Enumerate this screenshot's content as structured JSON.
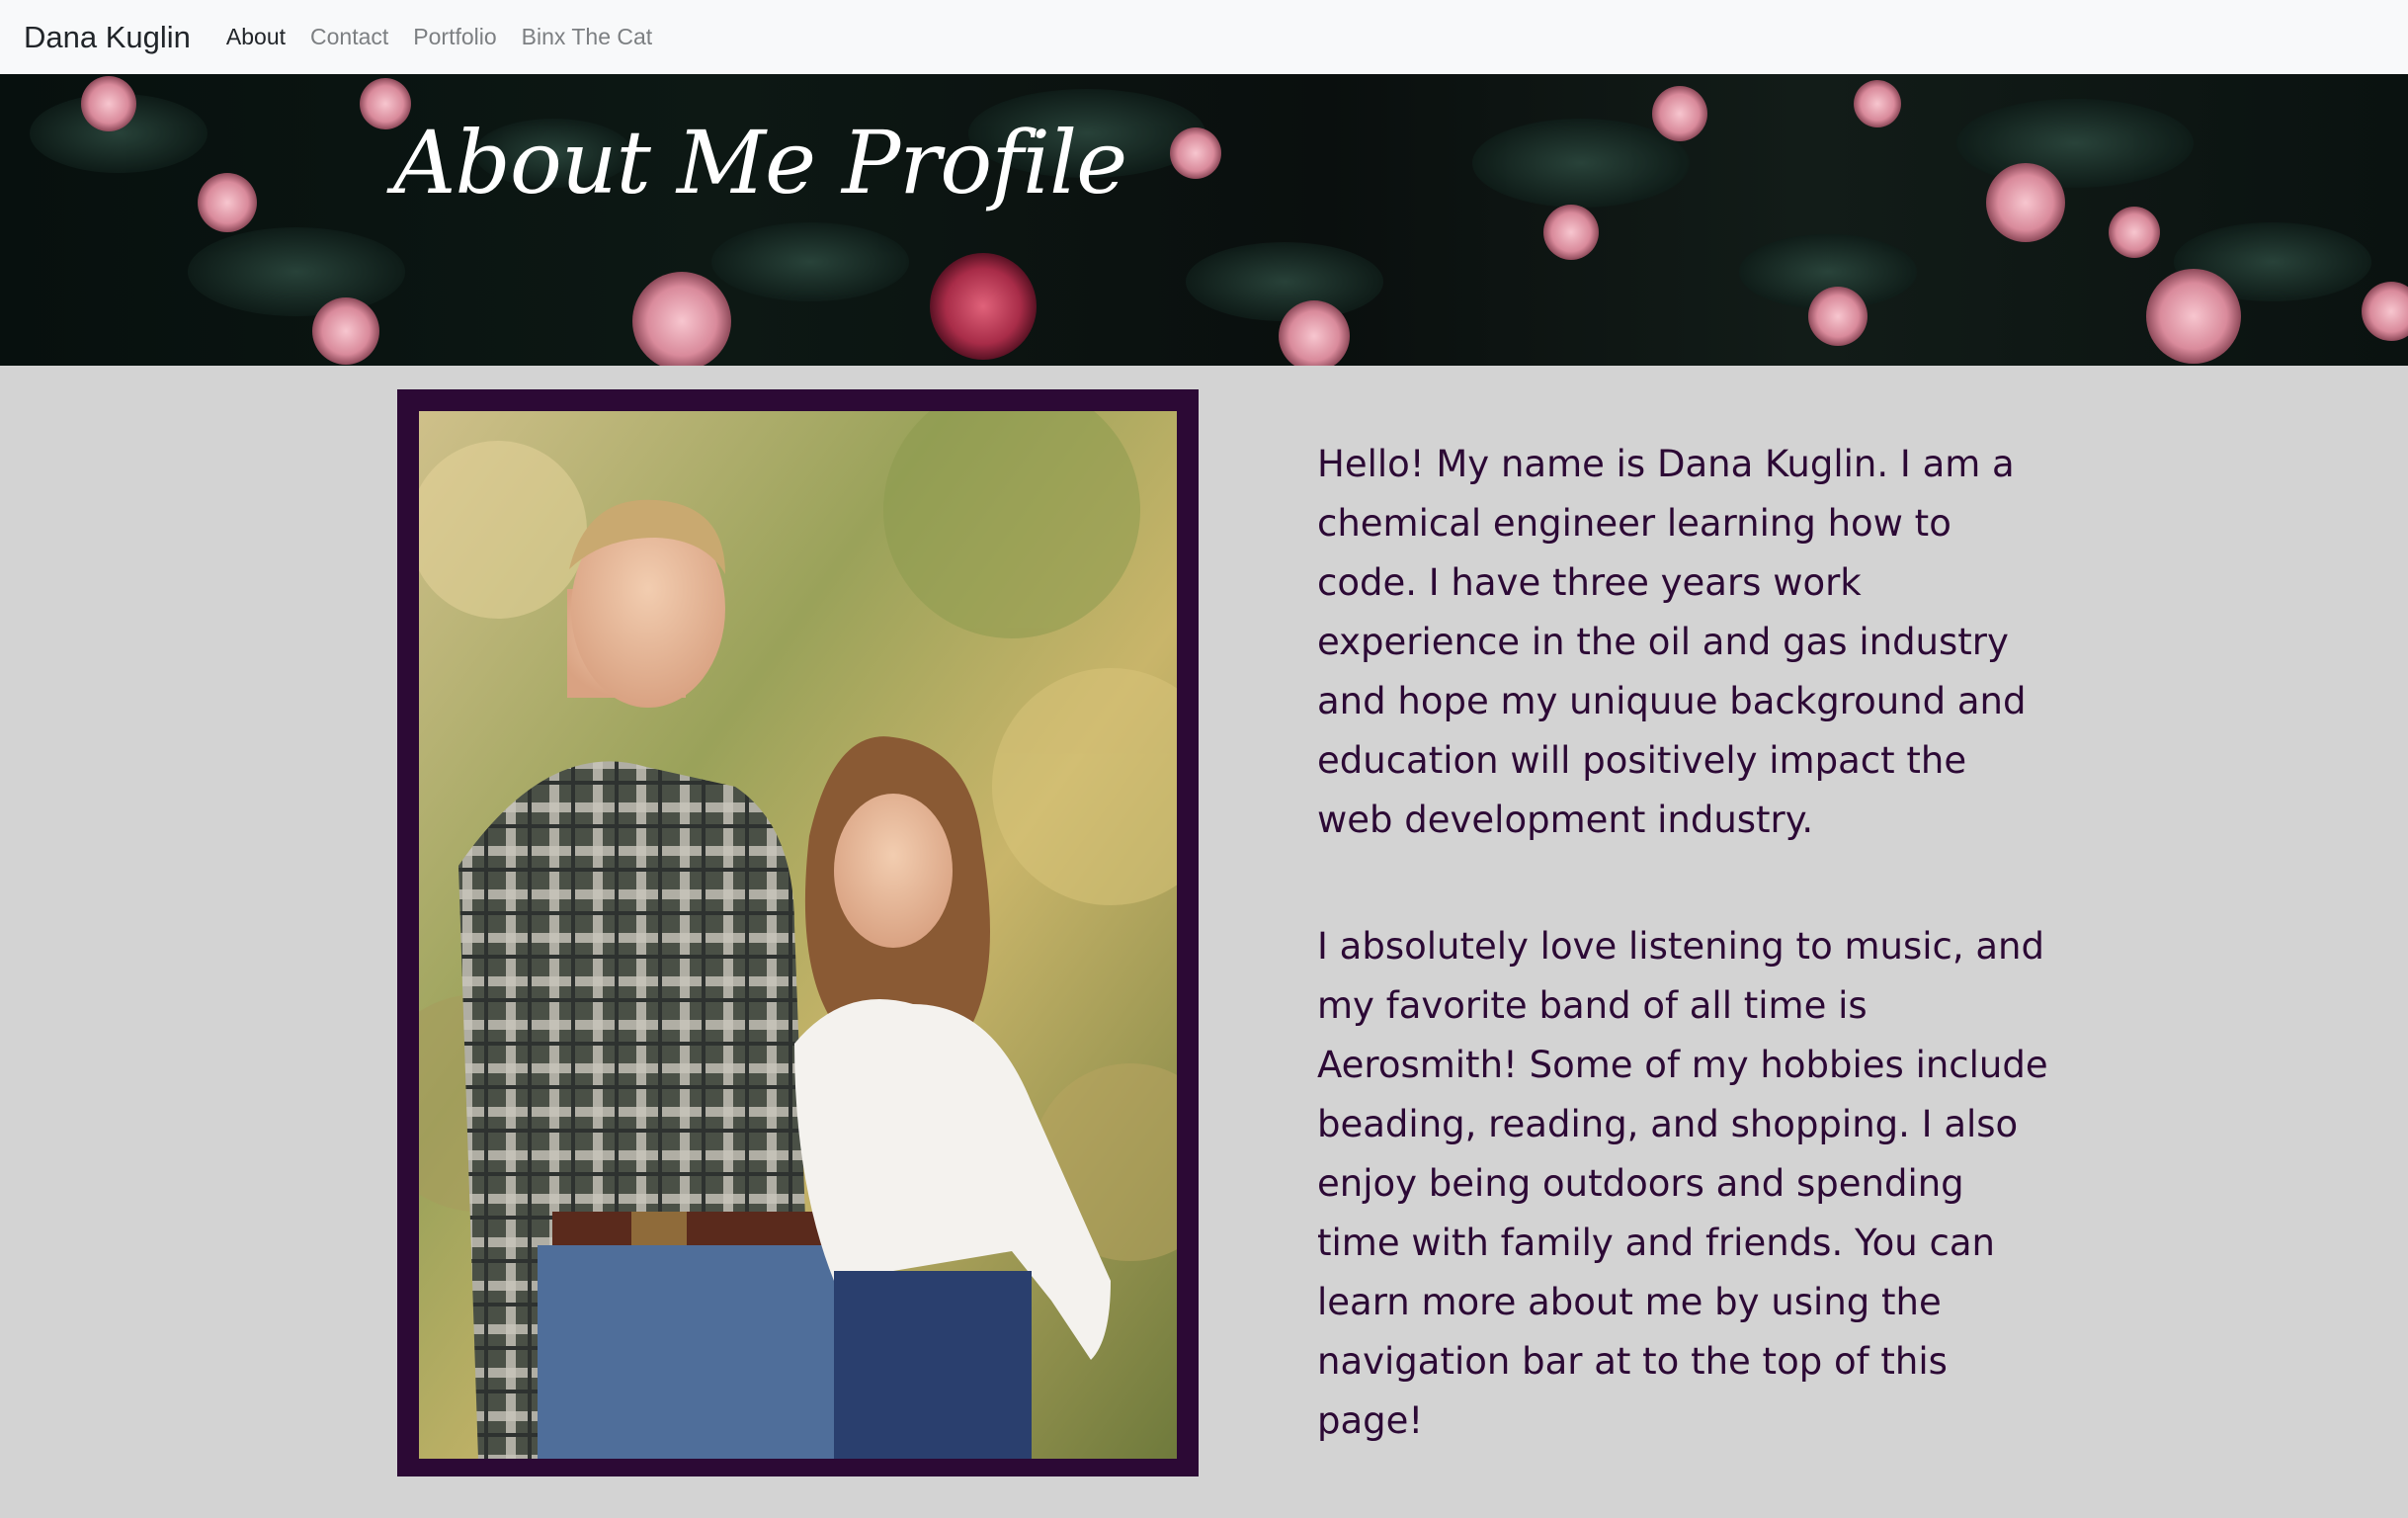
{
  "navbar": {
    "brand": "Dana Kuglin",
    "links": [
      {
        "label": "About",
        "active": true
      },
      {
        "label": "Contact",
        "active": false
      },
      {
        "label": "Portfolio",
        "active": false
      },
      {
        "label": "Binx The Cat",
        "active": false
      }
    ]
  },
  "hero": {
    "title": "About Me Profile"
  },
  "main": {
    "paragraphs": [
      "Hello! My name is Dana Kuglin. I am a chemical engineer learning how to code. I have three years work experience in the oil and gas industry and hope my uniquue background and education will positively impact the web development industry.",
      "I absolutely love listening to music, and my favorite band of all time is Aerosmith! Some of my hobbies include beading, reading, and shopping. I also enjoy being outdoors and spending time with family and friends. You can learn more about me by using the navigation bar at to the top of this page!"
    ]
  },
  "colors": {
    "accent": "#2c0935",
    "page_background": "#d3d3d3",
    "navbar_background": "#f8f9fa"
  }
}
